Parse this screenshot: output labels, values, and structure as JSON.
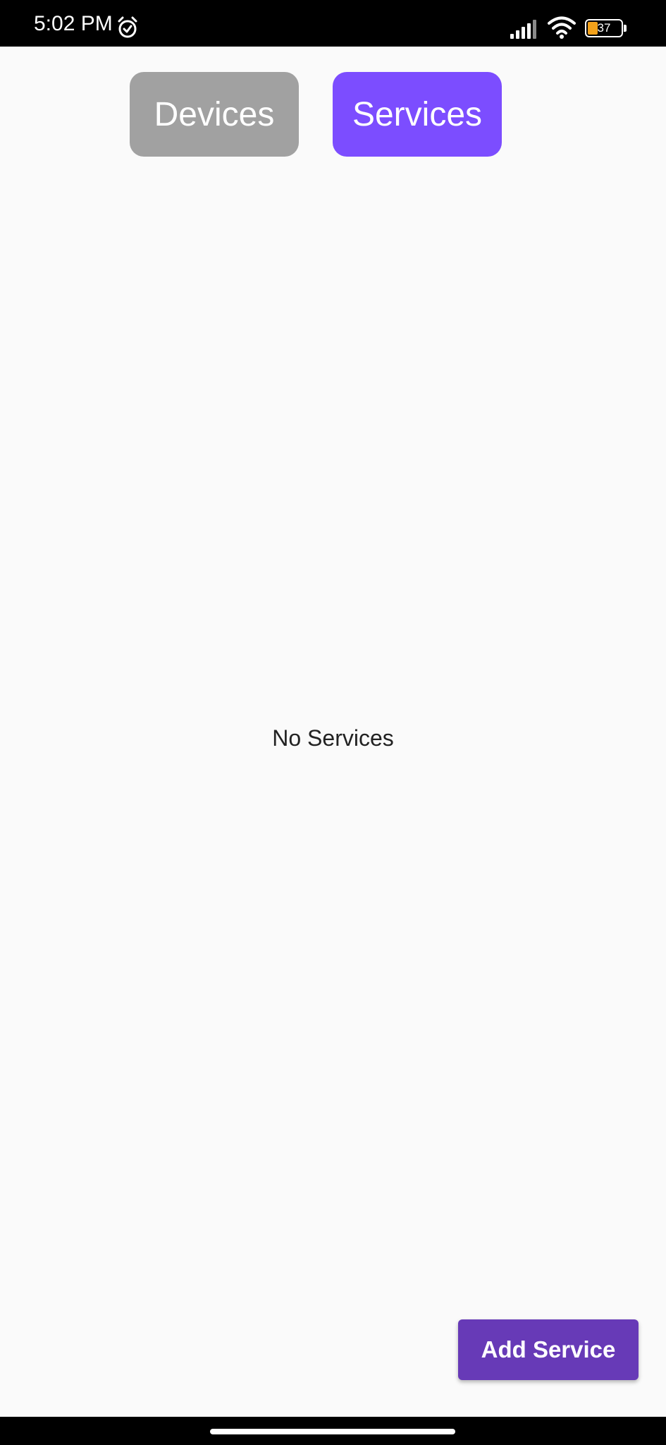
{
  "status_bar": {
    "time": "5:02 PM",
    "alarm_icon": "alarm-clock-icon",
    "signal_icon": "cellular-signal-icon",
    "wifi_icon": "wifi-icon",
    "battery_level": "37",
    "battery_color": "#f3a21b"
  },
  "tabs": [
    {
      "label": "Devices",
      "selected": false,
      "color": "#a1a1a1"
    },
    {
      "label": "Services",
      "selected": true,
      "color": "#7c4dff"
    }
  ],
  "main": {
    "empty_message": "No Services"
  },
  "actions": {
    "add_service_label": "Add Service",
    "add_service_color": "#673ab7"
  }
}
